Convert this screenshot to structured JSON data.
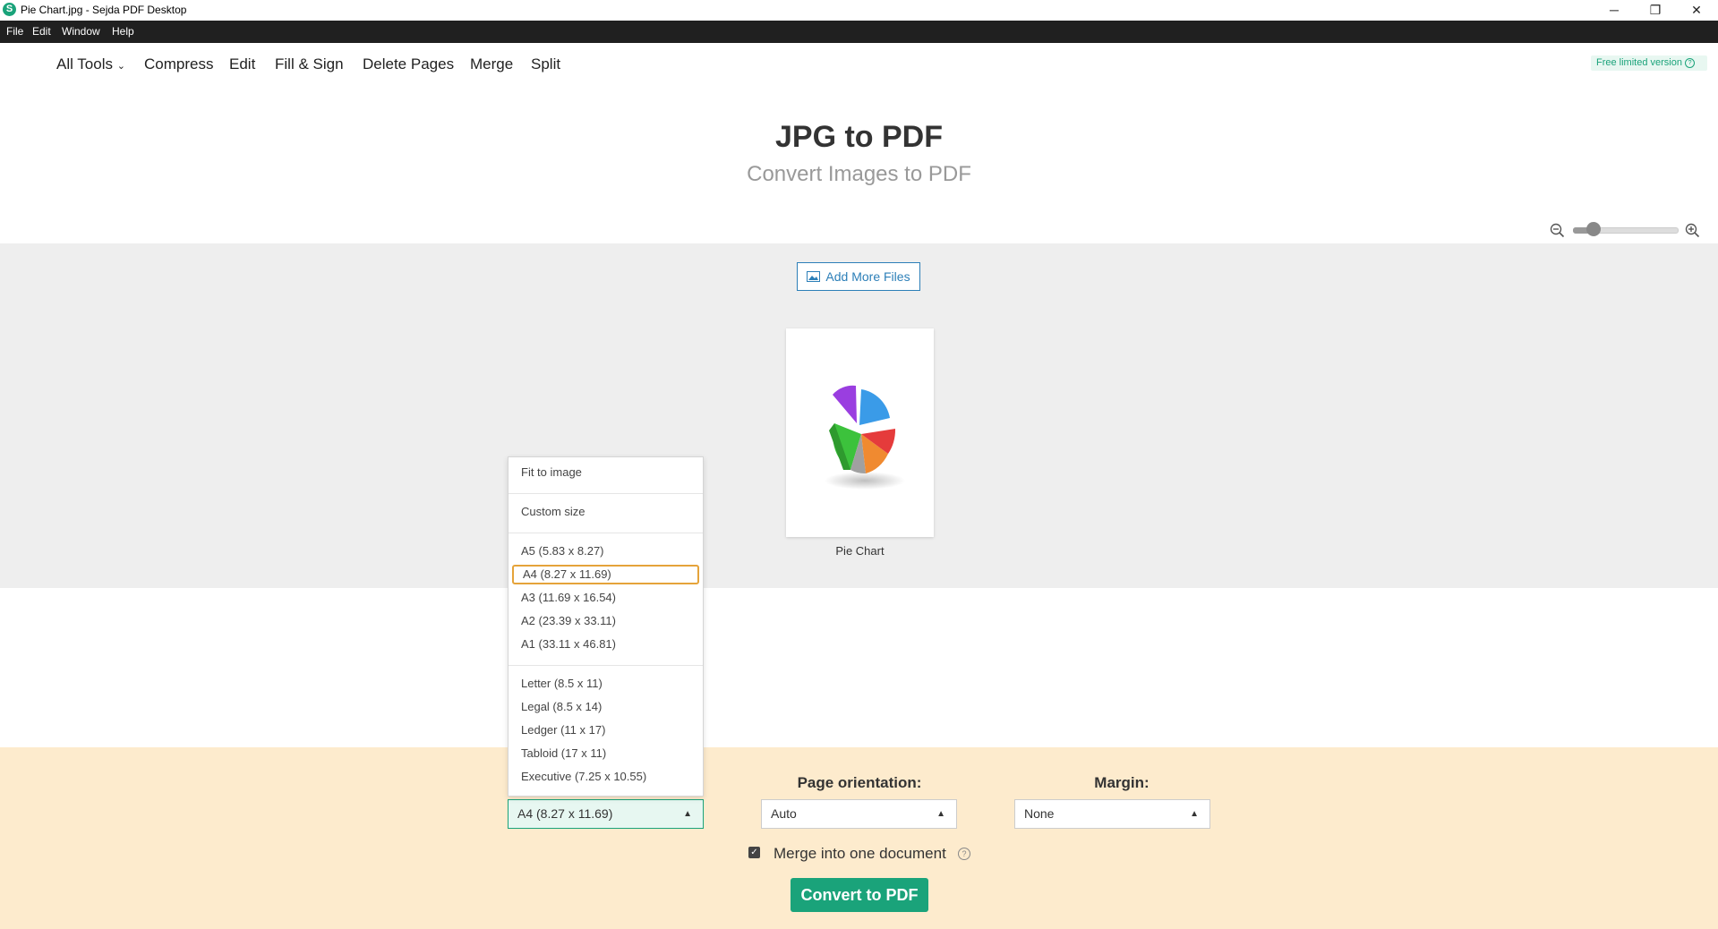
{
  "window": {
    "title": "Pie Chart.jpg - Sejda PDF Desktop",
    "app_icon": "S",
    "controls": [
      "─",
      "❐",
      "✕"
    ]
  },
  "menubar": [
    "File",
    "Edit",
    "Window",
    "Help"
  ],
  "nav": {
    "items": [
      "All Tools",
      "Compress",
      "Edit",
      "Fill & Sign",
      "Delete Pages",
      "Merge",
      "Split"
    ],
    "badge": "Free limited version"
  },
  "heading": {
    "title": "JPG to PDF",
    "subtitle": "Convert Images to PDF"
  },
  "zoom": {
    "level": 0.2
  },
  "files": {
    "add_more_label": "Add More Files",
    "thumbnail_label": "Pie Chart"
  },
  "page_size_menu": {
    "groups": [
      [
        "Fit to image"
      ],
      [
        "Custom size"
      ],
      [
        "A5 (5.83 x 8.27)",
        "A4 (8.27 x 11.69)",
        "A3 (11.69 x 16.54)",
        "A2 (23.39 x 33.11)",
        "A1 (33.11 x 46.81)"
      ],
      [
        "Letter (8.5 x 11)",
        "Legal (8.5 x 14)",
        "Ledger (11 x 17)",
        "Tabloid (17 x 11)",
        "Executive (7.25 x 10.55)"
      ]
    ],
    "selected": "A4 (8.27 x 11.69)"
  },
  "options": {
    "page_size_value": "A4 (8.27 x 11.69)",
    "orientation_label": "Page orientation:",
    "orientation_value": "Auto",
    "margin_label": "Margin:",
    "margin_value": "None",
    "merge_label": "Merge into one document",
    "merge_checked": true,
    "convert_label": "Convert to PDF"
  },
  "colors": {
    "accent": "#1aa37a",
    "link": "#2c7fb8",
    "options_bg": "#fdebcd",
    "highlight": "#e5a33a"
  }
}
